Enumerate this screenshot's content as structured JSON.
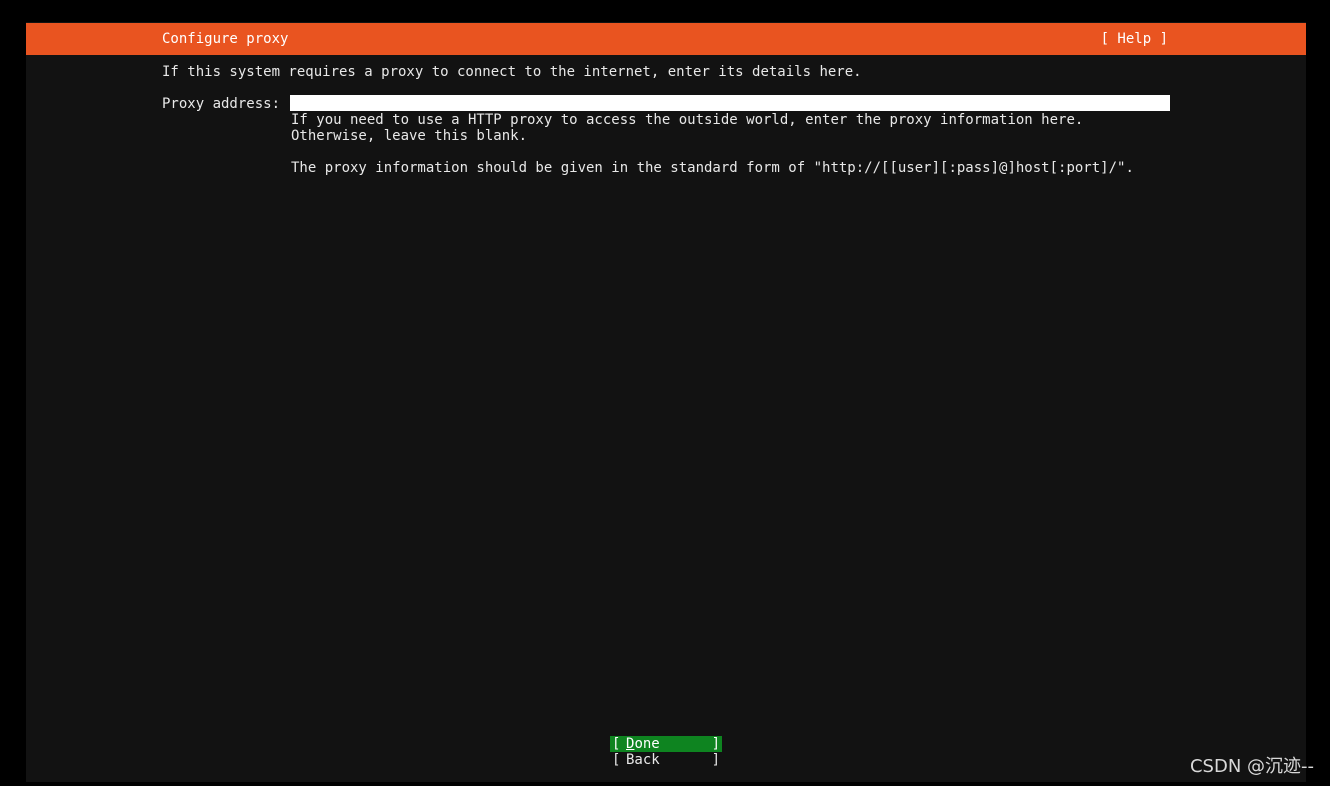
{
  "header": {
    "title": "Configure proxy",
    "help_label": "[ Help ]"
  },
  "intro_text": "If this system requires a proxy to connect to the internet, enter its details here.",
  "proxy_field": {
    "label": "Proxy address:",
    "value": "",
    "hint": "If you need to use a HTTP proxy to access the outside world, enter the proxy information here. Otherwise, leave this blank.",
    "format_hint": "The proxy information should be given in the standard form of \"http://[[user][:pass]@]host[:port]/\"."
  },
  "buttons": {
    "done": {
      "open_bracket": "[",
      "mnemonic": "D",
      "rest": "one",
      "close_bracket": "]"
    },
    "back": {
      "open_bracket": "[",
      "label": "Back",
      "close_bracket": "]"
    }
  },
  "watermark": "CSDN @沉迹--",
  "colors": {
    "accent": "#e95420",
    "background": "#121212",
    "focus_button": "#0e8420",
    "text": "#e8e8e8"
  }
}
